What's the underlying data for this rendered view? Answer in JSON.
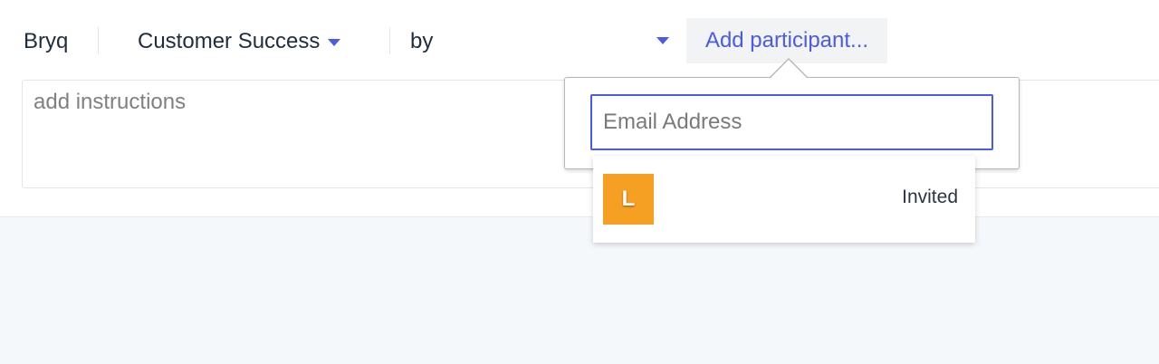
{
  "toolbar": {
    "org_name": "Bryq",
    "team_select": {
      "selected": "Customer Success",
      "icon": "chevron-down-icon"
    },
    "by_select": {
      "label": "by",
      "icon": "chevron-down-icon"
    },
    "add_participant_label": "Add participant..."
  },
  "instructions": {
    "placeholder": "add instructions",
    "value": ""
  },
  "participant_popover": {
    "email_placeholder": "Email Address",
    "email_value": "",
    "suggestions": [
      {
        "initial": "L",
        "status": "Invited",
        "avatar_color": "#f5a023"
      }
    ]
  },
  "colors": {
    "accent": "#4a5be8",
    "text": "#1f2d3d",
    "lower_background": "#f5f8fb",
    "add_button_background": "#f2f3f5"
  }
}
